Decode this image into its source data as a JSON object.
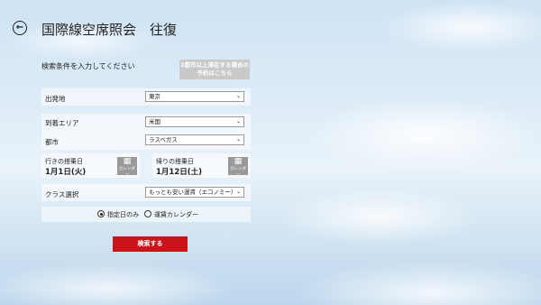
{
  "header": {
    "back_icon": "back-arrow-icon",
    "title": "国際線空席照会　往復"
  },
  "form": {
    "prompt": "検索条件を入力してください",
    "multi_city_btn": "2都市以上滞在する場合の予約はこちら",
    "departure": {
      "label": "出発地",
      "value": "東京"
    },
    "arrival_area": {
      "label": "到着エリア",
      "value": "米国"
    },
    "city": {
      "label": "都市",
      "value": "ラスベガス"
    },
    "outbound": {
      "label": "行きの搭乗日",
      "date": "1月1日(火)",
      "calendar_label": "カレンダー"
    },
    "return": {
      "label": "帰りの搭乗日",
      "date": "1月12日(土)",
      "calendar_label": "カレンダー"
    },
    "cabin": {
      "label": "クラス選択",
      "value": "もっとも安い運賃（エコノミー）"
    },
    "date_mode": {
      "options": [
        "指定日のみ",
        "運賃カレンダー"
      ],
      "selected": 0
    },
    "search_btn": "検索する"
  },
  "colors": {
    "accent": "#c8151b"
  }
}
